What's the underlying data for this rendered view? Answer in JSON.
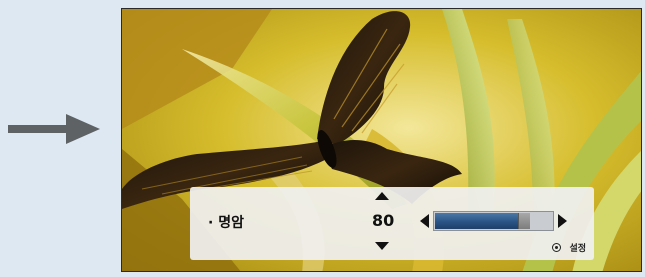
{
  "colors": {
    "page_background": "#dde8f3",
    "indicator_arrow": "#5f6265",
    "slider_fill": "#2a5486"
  },
  "osd": {
    "setting_label": "· 명암",
    "value": "80",
    "level_percent": 80,
    "hint_label": "설정",
    "icons": {
      "up": "triangle-up-icon",
      "down": "triangle-down-icon",
      "left": "triangle-left-icon",
      "right": "triangle-right-icon",
      "enter": "enter-circle-icon"
    }
  }
}
